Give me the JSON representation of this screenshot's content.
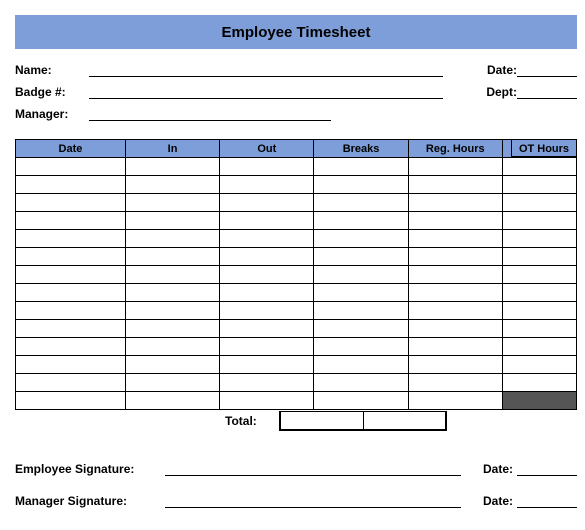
{
  "header": {
    "title": "Employee Timesheet"
  },
  "meta": {
    "name_label": "Name:",
    "name_value": "",
    "badge_label": "Badge #:",
    "badge_value": "",
    "manager_label": "Manager:",
    "manager_value": "",
    "date_label": "Date:",
    "date_value": "",
    "dept_label": "Dept:",
    "dept_value": ""
  },
  "table": {
    "ot_header": "OT Hours",
    "columns": {
      "date": "Date",
      "in": "In",
      "out": "Out",
      "breaks": "Breaks",
      "reg_hours": "Reg. Hours",
      "ot": ""
    },
    "rows": [
      {
        "date": "",
        "in": "",
        "out": "",
        "breaks": "",
        "reg": "",
        "ot": ""
      },
      {
        "date": "",
        "in": "",
        "out": "",
        "breaks": "",
        "reg": "",
        "ot": ""
      },
      {
        "date": "",
        "in": "",
        "out": "",
        "breaks": "",
        "reg": "",
        "ot": ""
      },
      {
        "date": "",
        "in": "",
        "out": "",
        "breaks": "",
        "reg": "",
        "ot": ""
      },
      {
        "date": "",
        "in": "",
        "out": "",
        "breaks": "",
        "reg": "",
        "ot": ""
      },
      {
        "date": "",
        "in": "",
        "out": "",
        "breaks": "",
        "reg": "",
        "ot": ""
      },
      {
        "date": "",
        "in": "",
        "out": "",
        "breaks": "",
        "reg": "",
        "ot": ""
      },
      {
        "date": "",
        "in": "",
        "out": "",
        "breaks": "",
        "reg": "",
        "ot": ""
      },
      {
        "date": "",
        "in": "",
        "out": "",
        "breaks": "",
        "reg": "",
        "ot": ""
      },
      {
        "date": "",
        "in": "",
        "out": "",
        "breaks": "",
        "reg": "",
        "ot": ""
      },
      {
        "date": "",
        "in": "",
        "out": "",
        "breaks": "",
        "reg": "",
        "ot": ""
      },
      {
        "date": "",
        "in": "",
        "out": "",
        "breaks": "",
        "reg": "",
        "ot": ""
      },
      {
        "date": "",
        "in": "",
        "out": "",
        "breaks": "",
        "reg": "",
        "ot": ""
      },
      {
        "date": "",
        "in": "",
        "out": "",
        "breaks": "",
        "reg": "",
        "ot": ""
      }
    ],
    "total_label": "Total:",
    "total_breaks": "",
    "total_reg": ""
  },
  "signatures": {
    "employee_label": "Employee Signature:",
    "employee_value": "",
    "employee_date": "",
    "manager_label": "Manager Signature:",
    "manager_value": "",
    "manager_date": "",
    "date_label": "Date:"
  }
}
